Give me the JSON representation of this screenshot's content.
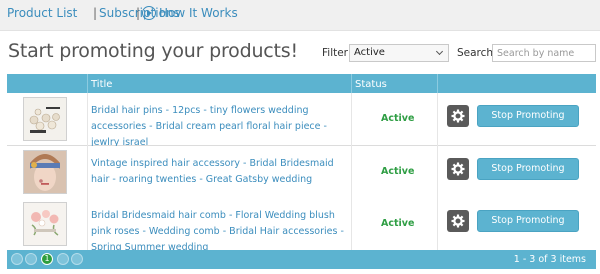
{
  "nav": {
    "product_list": "Product List",
    "separator": "|",
    "subscriptions": "Subscriptions",
    "how_it_works": "How It Works"
  },
  "page": {
    "heading": "Start promoting your products!"
  },
  "filter": {
    "label": "Filter:",
    "selected": "Active"
  },
  "search": {
    "label": "Search:",
    "placeholder": "Search by name"
  },
  "table": {
    "headers": {
      "title": "Title",
      "status": "Status"
    },
    "rows": [
      {
        "title": "Bridal hair pins - 12pcs - tiny flowers wedding accessories - Bridal cream pearl floral hair piece - jewlry israel",
        "status": "Active",
        "action": "Stop Promoting",
        "thumb": "hair-pins-thumb"
      },
      {
        "title": "Vintage inspired hair accessory - Bridal Bridesmaid hair - roaring twenties - Great Gatsby wedding",
        "status": "Active",
        "action": "Stop Promoting",
        "thumb": "vintage-hair-thumb"
      },
      {
        "title": "Bridal Bridesmaid hair comb - Floral Wedding blush pink roses - Wedding comb - Bridal Hair accessories - Spring Summer wedding",
        "status": "Active",
        "action": "Stop Promoting",
        "thumb": "hair-comb-thumb"
      }
    ]
  },
  "pagination": {
    "current": "1",
    "range": "1 - 3 of 3 items"
  },
  "colors": {
    "accent": "#5cb3d0",
    "link": "#3b8dbd",
    "status_active": "#2f9e44",
    "gear_button": "#5a5a5a",
    "page_active": "#2e9e3e"
  }
}
